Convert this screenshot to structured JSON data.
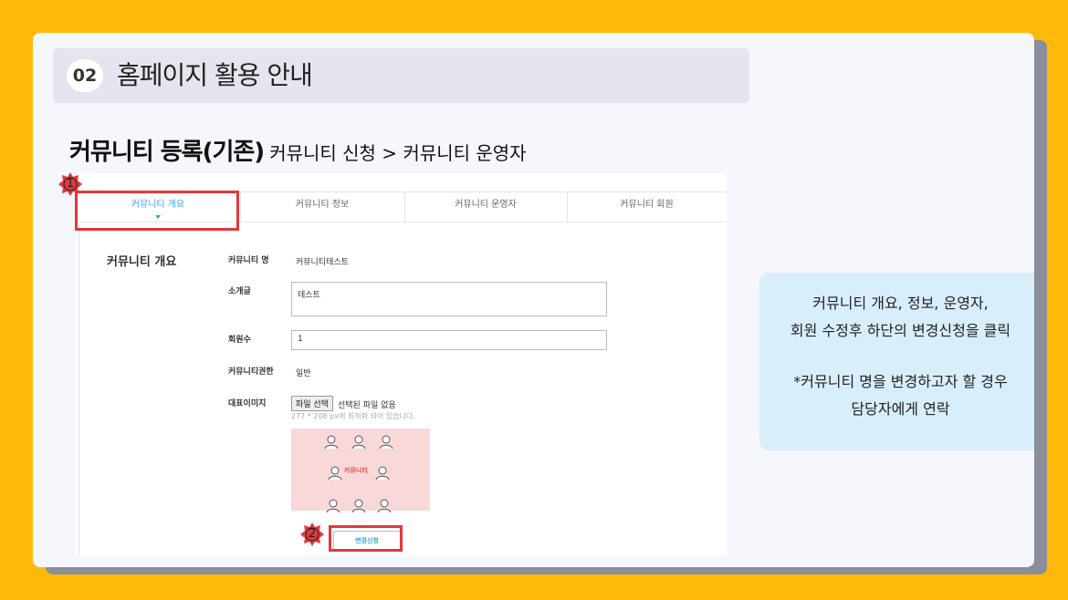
{
  "header": {
    "number": "02",
    "title": "홈페이지 활용 안내"
  },
  "heading": {
    "main": "커뮤니티 등록(기존)",
    "sub": "커뮤니티 신청 > 커뮤니티 운영자"
  },
  "screenshot": {
    "tabs": [
      {
        "label": "커뮤니티 개요",
        "active": true
      },
      {
        "label": "커뮤니티 정보",
        "active": false
      },
      {
        "label": "커뮤니티 운영자",
        "active": false
      },
      {
        "label": "커뮤니티 회원",
        "active": false
      }
    ],
    "section_label": "커뮤니티 개요",
    "fields": {
      "name_label": "커뮤니티 명",
      "name_value": "커뮤니티테스트",
      "intro_label": "소개글",
      "intro_value": "테스트",
      "members_label": "회원수",
      "members_value": "1",
      "permission_label": "커뮤니티권한",
      "permission_value": "일반",
      "image_label": "대표이미지"
    },
    "file": {
      "button_label": "파일 선택",
      "status": "선택된 파일 없음",
      "hint": "277 * 208 px에 최적화 되어 있습니다."
    },
    "preview_caption": "커뮤니티",
    "change_button": "변경신청"
  },
  "markers": {
    "one": "1",
    "two": "2"
  },
  "info": {
    "line1": "커뮤니티 개요, 정보, 운영자,",
    "line2": "회원 수정후 하단의 변경신청을 클릭",
    "line3": "*커뮤니티 명을 변경하고자 할 경우",
    "line4": "담당자에게 연락"
  },
  "colors": {
    "background": "#FFB90B",
    "highlight": "#E0383C",
    "accent": "#3FA3DC",
    "info_box": "#D8EEFB"
  }
}
